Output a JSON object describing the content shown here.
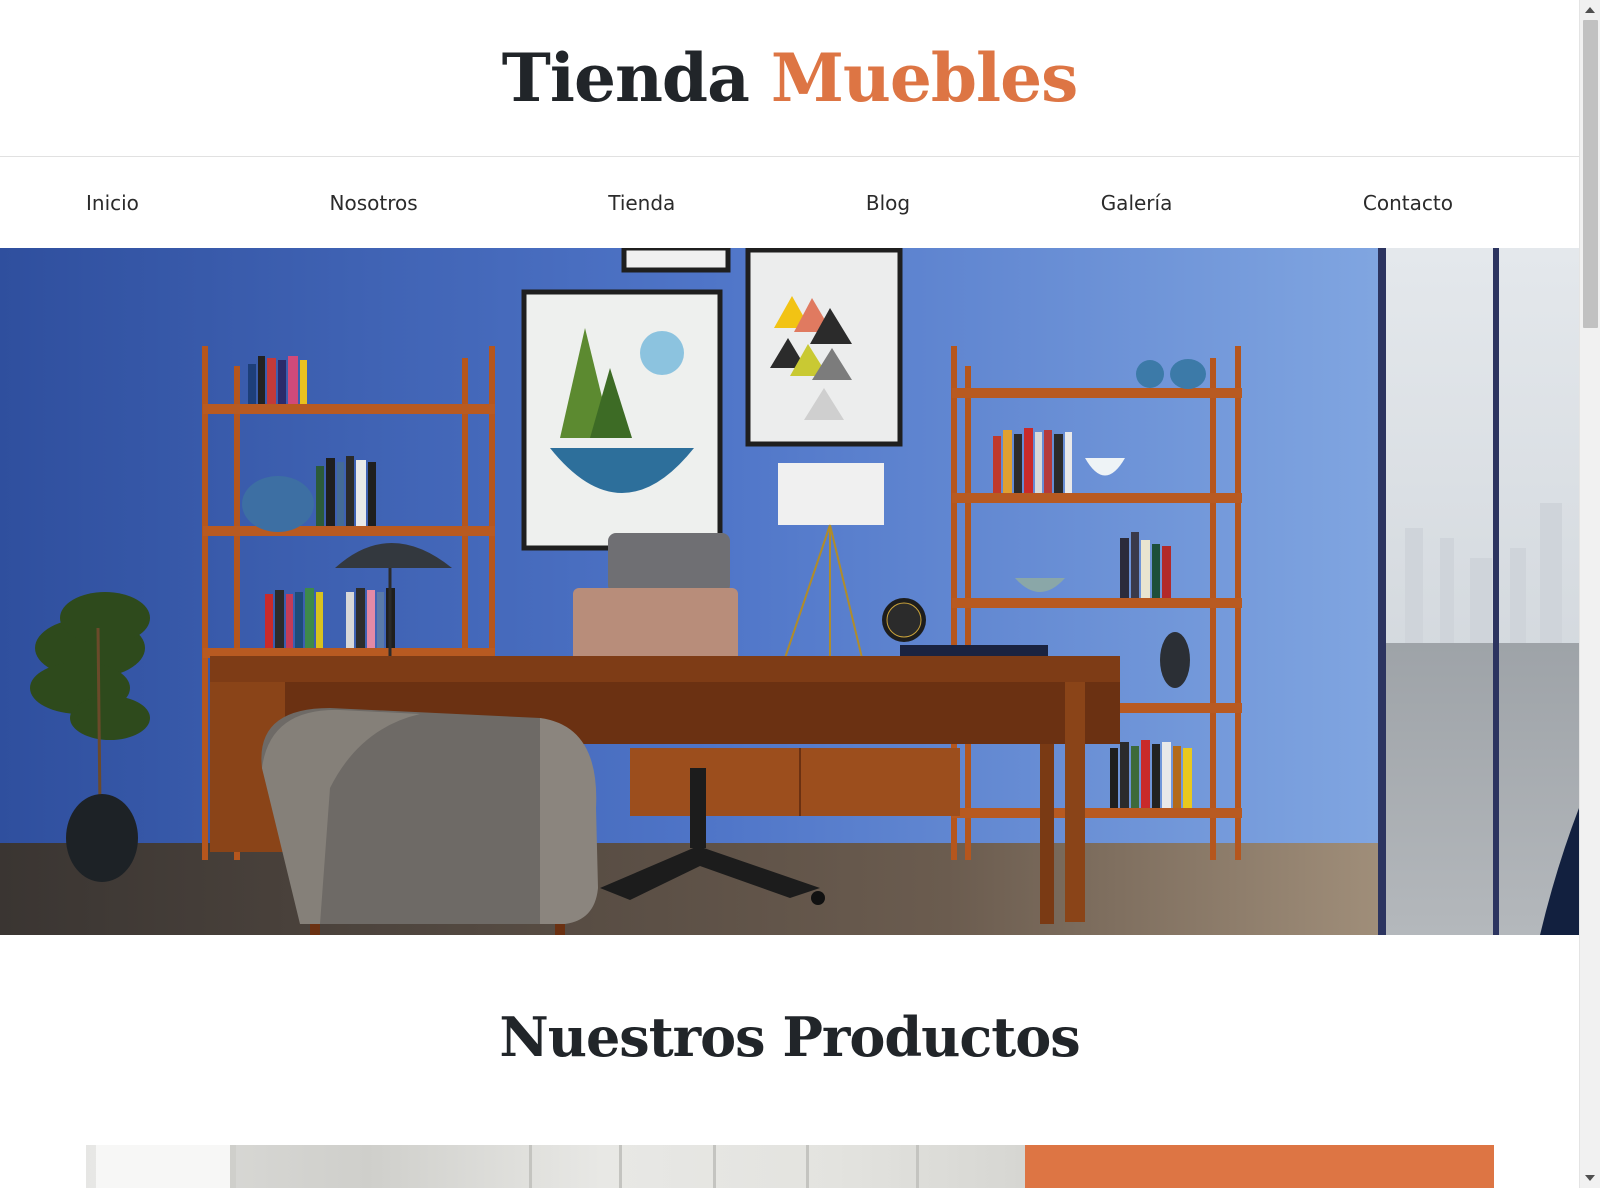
{
  "header": {
    "logo_part1": "Tienda",
    "logo_part2": "Muebles"
  },
  "nav": {
    "items": [
      {
        "label": "Inicio"
      },
      {
        "label": "Nosotros"
      },
      {
        "label": "Tienda"
      },
      {
        "label": "Blog"
      },
      {
        "label": "Galería"
      },
      {
        "label": "Contacto"
      }
    ]
  },
  "hero": {
    "image": "office-desk-bookshelves-blue-wall-photo"
  },
  "products": {
    "title": "Nuestros Productos"
  },
  "colors": {
    "accent": "#dd7544",
    "text": "#212529",
    "wall_blue": "#4b6fc0"
  }
}
